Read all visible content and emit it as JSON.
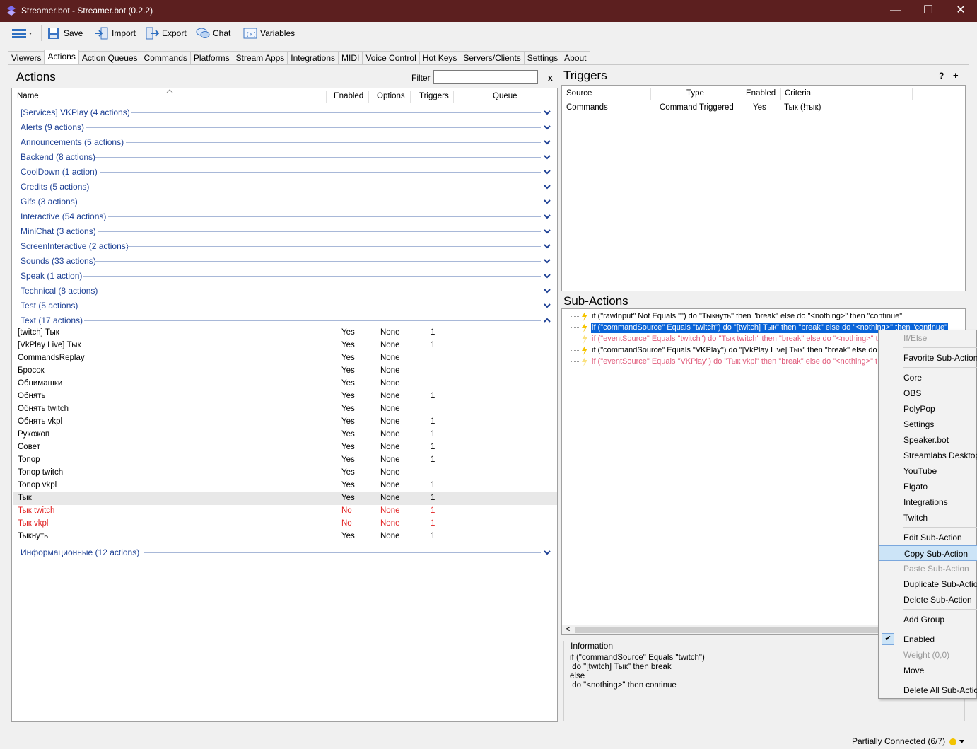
{
  "window": {
    "title": "Streamer.bot - Streamer.bot (0.2.2)",
    "minimize": "—",
    "maximize": "☐",
    "close": "✕"
  },
  "toolbar": {
    "save": "Save",
    "import": "Import",
    "export": "Export",
    "chat": "Chat",
    "variables": "Variables"
  },
  "tabs": [
    "Viewers",
    "Actions",
    "Action Queues",
    "Commands",
    "Platforms",
    "Stream Apps",
    "Integrations",
    "MIDI",
    "Voice Control",
    "Hot Keys",
    "Servers/Clients",
    "Settings",
    "About"
  ],
  "actions": {
    "title": "Actions",
    "filter_label": "Filter",
    "filter_value": "",
    "clear": "x",
    "columns": {
      "name": "Name",
      "enabled": "Enabled",
      "options": "Options",
      "triggers": "Triggers",
      "queue": "Queue"
    },
    "groups_before": [
      "[Services] VKPlay (4 actions)",
      "Alerts (9 actions)",
      "Announcements (5 actions)",
      "Backend (8 actions)",
      "CoolDown (1 action)",
      "Credits (5 actions)",
      "Gifs (3 actions)",
      "Interactive (54 actions)",
      "MiniChat (3 actions)",
      "ScreenInteractive (2 actions)",
      "Sounds (33 actions)",
      "Speak (1 action)",
      "Technical (8 actions)",
      "Test (5 actions)",
      "Text (17 actions)"
    ],
    "rows": [
      {
        "name": "[twitch] Тык",
        "enabled": "Yes",
        "options": "None",
        "triggers": "1",
        "red": false
      },
      {
        "name": "[VkPlay Live] Тык",
        "enabled": "Yes",
        "options": "None",
        "triggers": "1",
        "red": false
      },
      {
        "name": "CommandsReplay",
        "enabled": "Yes",
        "options": "None",
        "triggers": "",
        "red": false
      },
      {
        "name": "Бросок",
        "enabled": "Yes",
        "options": "None",
        "triggers": "",
        "red": false
      },
      {
        "name": "Обнимашки",
        "enabled": "Yes",
        "options": "None",
        "triggers": "",
        "red": false
      },
      {
        "name": "Обнять",
        "enabled": "Yes",
        "options": "None",
        "triggers": "1",
        "red": false
      },
      {
        "name": "Обнять twitch",
        "enabled": "Yes",
        "options": "None",
        "triggers": "",
        "red": false
      },
      {
        "name": "Обнять vkpl",
        "enabled": "Yes",
        "options": "None",
        "triggers": "1",
        "red": false
      },
      {
        "name": "Рукожоп",
        "enabled": "Yes",
        "options": "None",
        "triggers": "1",
        "red": false
      },
      {
        "name": "Совет",
        "enabled": "Yes",
        "options": "None",
        "triggers": "1",
        "red": false
      },
      {
        "name": "Топор",
        "enabled": "Yes",
        "options": "None",
        "triggers": "1",
        "red": false
      },
      {
        "name": "Топор twitch",
        "enabled": "Yes",
        "options": "None",
        "triggers": "",
        "red": false
      },
      {
        "name": "Топор vkpl",
        "enabled": "Yes",
        "options": "None",
        "triggers": "1",
        "red": false
      },
      {
        "name": "Тык",
        "enabled": "Yes",
        "options": "None",
        "triggers": "1",
        "red": false,
        "selected": true
      },
      {
        "name": "Тык twitch",
        "enabled": "No",
        "options": "None",
        "triggers": "1",
        "red": true
      },
      {
        "name": "Тык vkpl",
        "enabled": "No",
        "options": "None",
        "triggers": "1",
        "red": true
      },
      {
        "name": "Тыкнуть",
        "enabled": "Yes",
        "options": "None",
        "triggers": "1",
        "red": false
      }
    ],
    "group_after": "Информационные (12 actions)"
  },
  "triggers": {
    "title": "Triggers",
    "help": "?",
    "add": "+",
    "columns": {
      "source": "Source",
      "type": "Type",
      "enabled": "Enabled",
      "criteria": "Criteria"
    },
    "rows": [
      {
        "source": "Commands",
        "type": "Command Triggered",
        "enabled": "Yes",
        "criteria": "Тык (!тык)"
      }
    ]
  },
  "subactions": {
    "title": "Sub-Actions",
    "items": [
      {
        "text": "if (\"rawInput\" Not Equals \"\") do \"Тыкнуть\" then \"break\" else do \"<nothing>\" then \"continue\"",
        "state": "normal"
      },
      {
        "text": "if (\"commandSource\" Equals \"twitch\") do \"[twitch] Тык\" then \"break\" else do \"<nothing>\" then \"continue\"",
        "state": "selected"
      },
      {
        "text": "if (\"eventSource\" Equals \"twitch\") do \"Тык twitch\" then \"break\" else do \"<nothing>\" t",
        "state": "disabled"
      },
      {
        "text": "if (\"commandSource\" Equals \"VKPlay\") do \"[VkPlay Live] Тык\" then \"break\" else do",
        "state": "normal"
      },
      {
        "text": "if (\"eventSource\" Equals \"VKPlay\") do \"Тык vkpl\" then \"break\" else do \"<nothing>\" t",
        "state": "disabled"
      }
    ],
    "scroll_left": "<",
    "info_label": "Information",
    "info_lines": [
      "if (\"commandSource\" Equals \"twitch\")",
      " do \"[twitch] Тык\" then break",
      "else",
      " do \"<nothing>\" then continue"
    ]
  },
  "context_menu": {
    "items": [
      {
        "label": "If/Else",
        "disabled": true
      },
      {
        "sep": true
      },
      {
        "label": "Favorite Sub-Actions"
      },
      {
        "sep": true
      },
      {
        "label": "Core"
      },
      {
        "label": "OBS"
      },
      {
        "label": "PolyPop"
      },
      {
        "label": "Settings"
      },
      {
        "label": "Speaker.bot"
      },
      {
        "label": "Streamlabs Desktop"
      },
      {
        "label": "YouTube"
      },
      {
        "label": "Elgato"
      },
      {
        "label": "Integrations"
      },
      {
        "label": "Twitch"
      },
      {
        "sep": true
      },
      {
        "label": "Edit Sub-Action"
      },
      {
        "label": "Copy Sub-Action",
        "highlight": true
      },
      {
        "label": "Paste Sub-Action",
        "disabled": true
      },
      {
        "label": "Duplicate Sub-Action"
      },
      {
        "label": "Delete Sub-Action"
      },
      {
        "sep": true
      },
      {
        "label": "Add Group"
      },
      {
        "sep": true
      },
      {
        "label": "Enabled",
        "checked": true
      },
      {
        "label": "Weight (0,0)",
        "disabled": true
      },
      {
        "label": "Move"
      },
      {
        "sep": true
      },
      {
        "label": "Delete All Sub-Actions"
      }
    ]
  },
  "status": {
    "text": "Partially Connected (6/7)",
    "dot_color": "#f2c300"
  }
}
